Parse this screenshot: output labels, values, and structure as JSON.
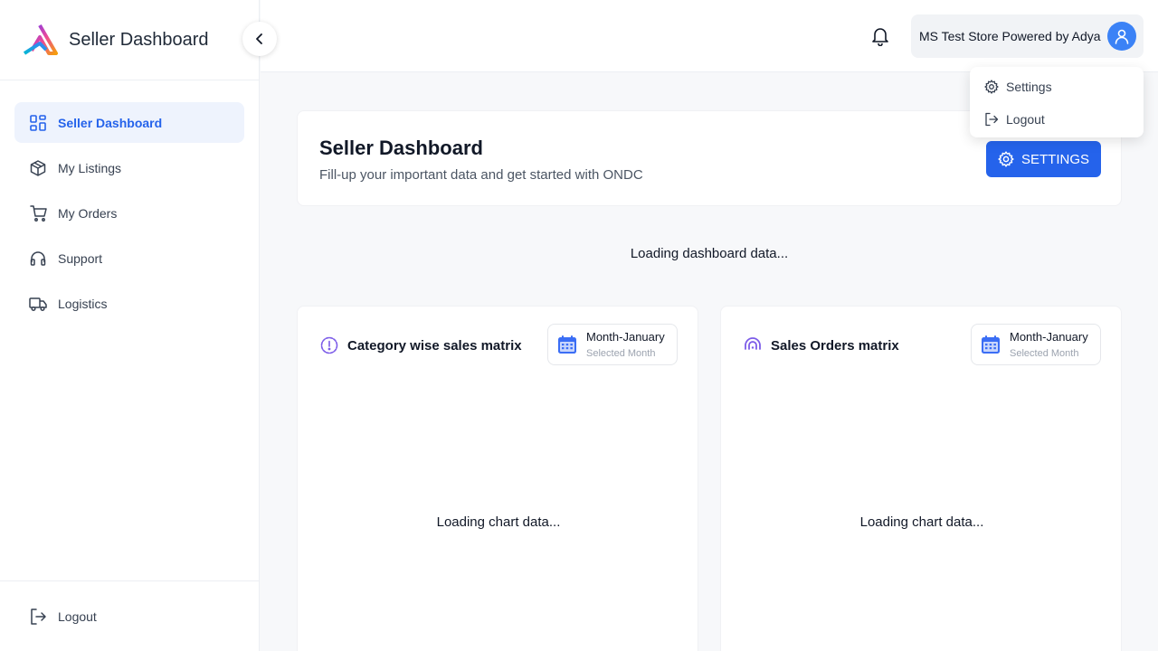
{
  "brand": {
    "title": "Seller Dashboard"
  },
  "sidebar": {
    "items": [
      {
        "label": "Seller Dashboard",
        "icon": "grid-icon",
        "active": true
      },
      {
        "label": "My Listings",
        "icon": "box-icon"
      },
      {
        "label": "My Orders",
        "icon": "cart-icon"
      },
      {
        "label": "Support",
        "icon": "headphones-icon"
      },
      {
        "label": "Logistics",
        "icon": "truck-icon"
      }
    ],
    "logout_label": "Logout"
  },
  "header": {
    "store_name": "MS Test Store Powered by Adya"
  },
  "user_menu": {
    "settings_label": "Settings",
    "logout_label": "Logout"
  },
  "main": {
    "title": "Seller Dashboard",
    "subtitle": "Fill-up your important data and get started with ONDC",
    "settings_button": "SETTINGS",
    "loading_text": "Loading dashboard data..."
  },
  "panels": [
    {
      "title": "Category wise sales matrix",
      "month_value": "Month-January",
      "month_hint": "Selected Month",
      "loading": "Loading chart data..."
    },
    {
      "title": "Sales Orders matrix",
      "month_value": "Month-January",
      "month_hint": "Selected Month",
      "loading": "Loading chart data..."
    }
  ],
  "colors": {
    "accent": "#2563eb",
    "active_bg": "#eef3fd",
    "avatar": "#3b82f6"
  }
}
